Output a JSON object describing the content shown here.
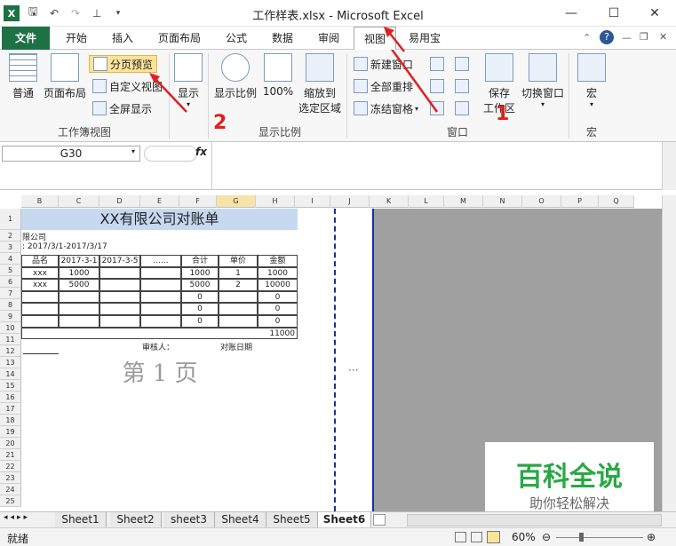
{
  "window": {
    "title": "工作样表.xlsx - Microsoft Excel"
  },
  "tabs": [
    "文件",
    "开始",
    "插入",
    "页面布局",
    "公式",
    "数据",
    "审阅",
    "视图",
    "易用宝"
  ],
  "ribbon": {
    "normal": "普通",
    "page_layout": "页面布局",
    "page_break_preview": "分页预览",
    "custom_views": "自定义视图",
    "full_screen": "全屏显示",
    "group_workbook_views": "工作簿视图",
    "show": "显示",
    "zoom": "显示比例",
    "zoom_100": "100%",
    "zoom_selection_l1": "缩放到",
    "zoom_selection_l2": "选定区域",
    "group_zoom": "显示比例",
    "new_window": "新建窗口",
    "arrange_all": "全部重排",
    "freeze_panes": "冻结窗格",
    "save_workspace_l1": "保存",
    "save_workspace_l2": "工作区",
    "switch_windows": "切换窗口",
    "group_window": "窗口",
    "macros": "宏",
    "group_macros": "宏"
  },
  "annotations": {
    "n1": "1",
    "n2": "2"
  },
  "formula_bar": {
    "name_box": "G30",
    "fx": "fx"
  },
  "columns": [
    "B",
    "C",
    "D",
    "E",
    "F",
    "G",
    "H",
    "I",
    "J",
    "K",
    "L",
    "M",
    "N",
    "O",
    "P",
    "Q"
  ],
  "rows": [
    "1",
    "2",
    "3",
    "4",
    "5",
    "6",
    "7",
    "8",
    "9",
    "10",
    "11",
    "12",
    "13",
    "14",
    "15",
    "16",
    "17",
    "18",
    "19",
    "20",
    "21",
    "22",
    "23",
    "24",
    "25"
  ],
  "sheet": {
    "title": "XX有限公司对账单",
    "company": "限公司",
    "period": ": 2017/3/1-2017/3/17",
    "headers": [
      "品名",
      "2017-3-1",
      "2017-3-5",
      "......",
      "合计",
      "单价",
      "金额"
    ],
    "rows": [
      [
        "xxx",
        "1000",
        "",
        "",
        "1000",
        "1",
        "1000"
      ],
      [
        "xxx",
        "5000",
        "",
        "",
        "5000",
        "2",
        "10000"
      ],
      [
        "",
        "",
        "",
        "",
        "0",
        "",
        "0"
      ],
      [
        "",
        "",
        "",
        "",
        "0",
        "",
        "0"
      ],
      [
        "",
        "",
        "",
        "",
        "0",
        "",
        "0"
      ]
    ],
    "total": "11000",
    "reviewer": "审核人：",
    "date_label": "对账日期",
    "page_label": "第 1 页",
    "ellipsis": "···"
  },
  "sheet_tabs": [
    "Sheet1",
    "Sheet2",
    "sheet3",
    "Sheet4",
    "Sheet5",
    "Sheet6"
  ],
  "status": {
    "ready": "就绪",
    "zoom": "60%"
  },
  "watermark": {
    "line1": "百科全说",
    "line2": "助你轻松解决"
  },
  "colors": {
    "file_tab": "#1e7145",
    "accent": "#2b579a",
    "arrow": "#e02020"
  }
}
